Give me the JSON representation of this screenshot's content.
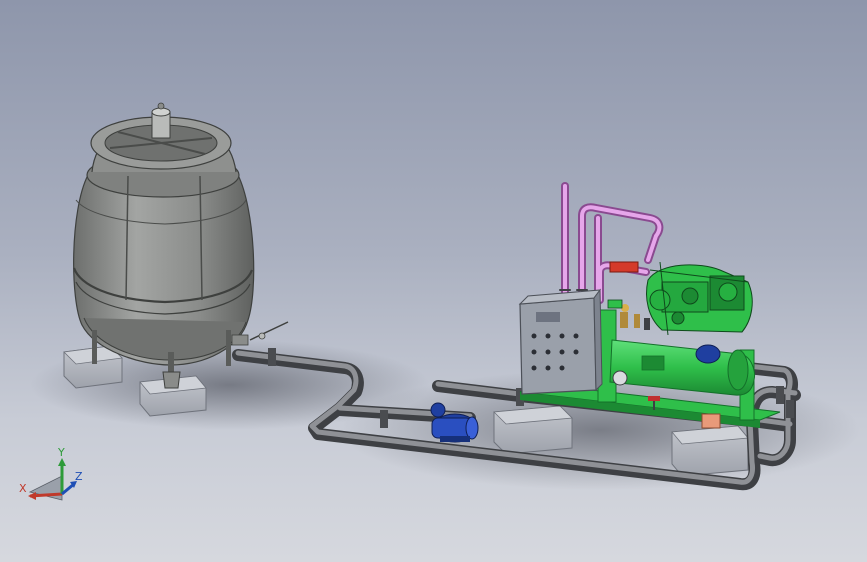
{
  "viewport": {
    "background_top": "#8e96ab",
    "background_bottom": "#d6d8de"
  },
  "triad": {
    "x_label": "X",
    "y_label": "Y",
    "z_label": "Z",
    "x_color": "#c0392b",
    "y_color": "#2e9b3a",
    "z_color": "#1f4fb5"
  },
  "colors": {
    "tank": "#8a8c8a",
    "pipe": "#6e7073",
    "refrigerant_line": "#d48ad8",
    "chiller_frame": "#2fbf4a",
    "pump": "#1f3fa0",
    "control_panel": "#9aa0aa",
    "base_block": "#a9adb6"
  },
  "parts": [
    "cooling-tower",
    "circulation-pump",
    "control-panel",
    "compressor-unit",
    "condenser-shell",
    "refrigerant-piping",
    "water-piping",
    "concrete-bases"
  ]
}
